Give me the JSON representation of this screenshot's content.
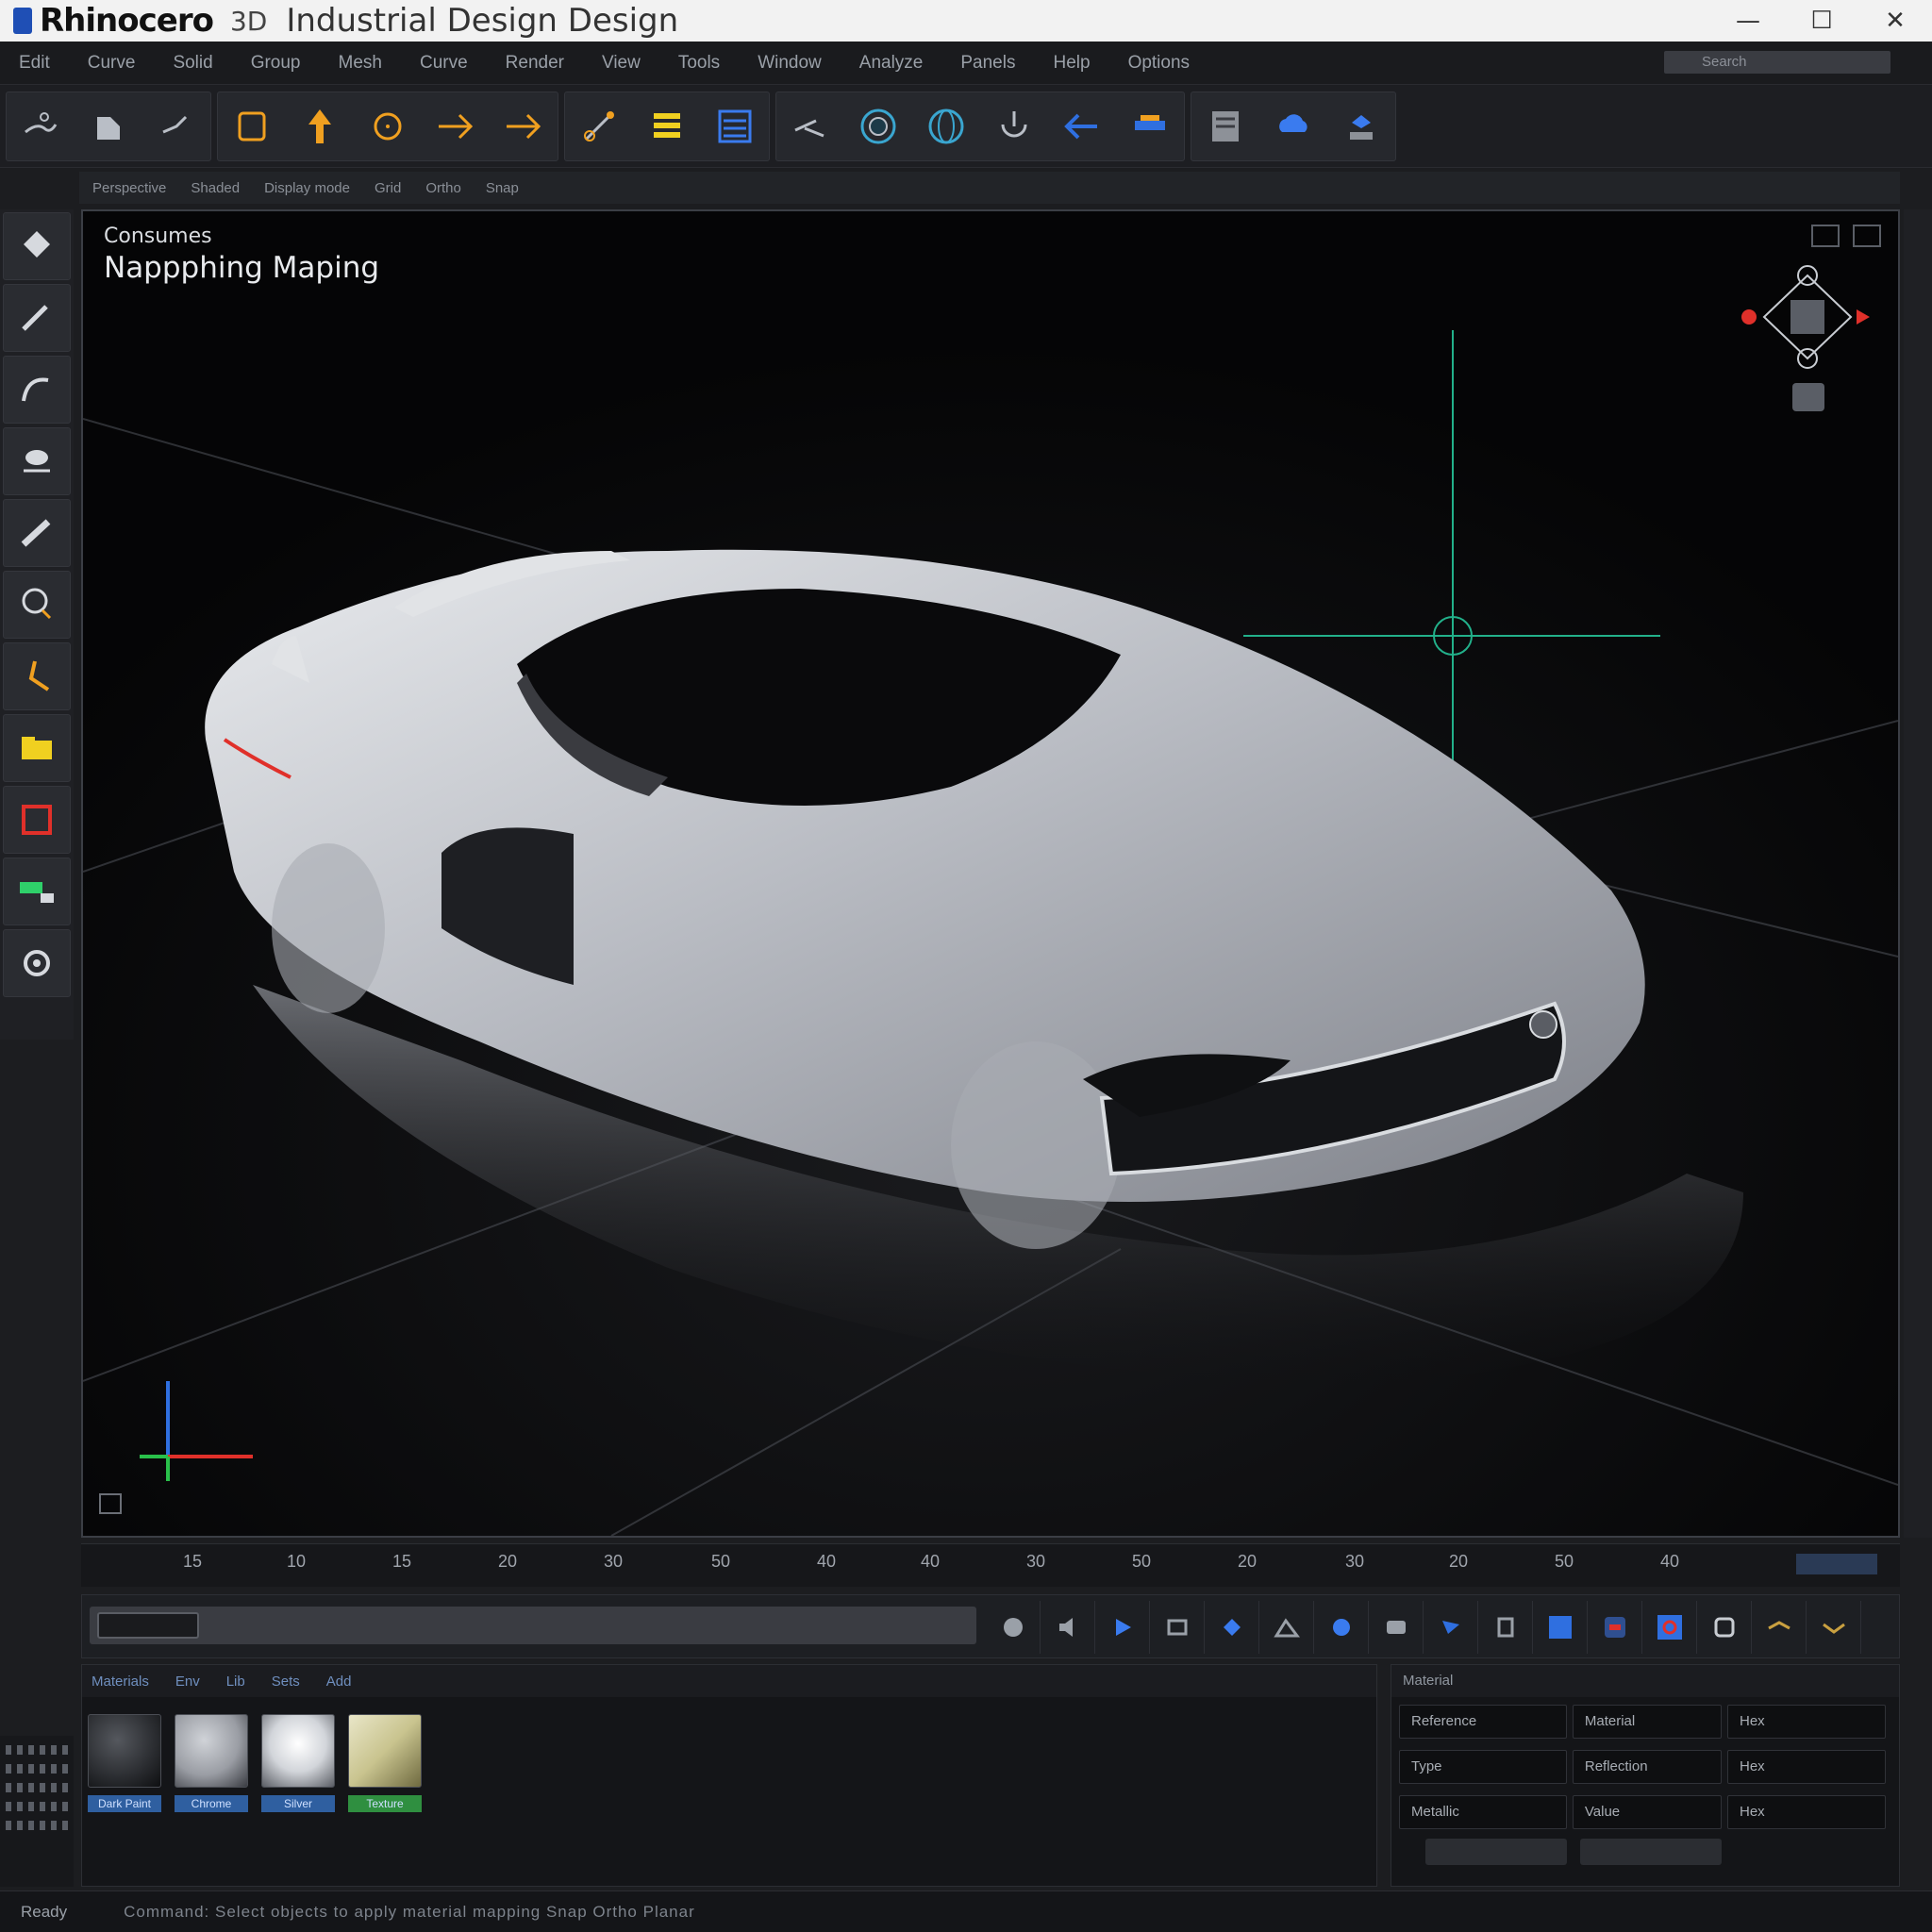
{
  "titlebar": {
    "app_name": "Rhinocero",
    "app_version": "3D",
    "document_title": "Industrial Design Design",
    "controls": {
      "minimize": "—",
      "maximize": "☐",
      "close": "✕"
    }
  },
  "menu": {
    "items": [
      "Edit",
      "Curve",
      "Solid",
      "Group",
      "Mesh",
      "Curve",
      "Render",
      "View",
      "Tools",
      "Window",
      "Analyze",
      "Panels",
      "Help",
      "Options"
    ],
    "search_placeholder": "Search"
  },
  "toolbar": {
    "tools": [
      {
        "icon": "select-icon",
        "color": "#b9bec6"
      },
      {
        "icon": "point-icon",
        "color": "#b9bec6"
      },
      {
        "icon": "line-icon",
        "color": "#b9bec6"
      },
      {
        "icon": "rectangle-icon",
        "color": "#f0a020"
      },
      {
        "icon": "move-icon",
        "color": "#f0a020"
      },
      {
        "icon": "circle-icon",
        "color": "#f0a020"
      },
      {
        "icon": "arrow-icon",
        "color": "#f0a020"
      },
      {
        "icon": "arrow-icon",
        "color": "#f0a020"
      },
      {
        "icon": "snap-icon",
        "color": "#f0a020"
      },
      {
        "icon": "layers-icon",
        "color": "#f0d020"
      },
      {
        "icon": "properties-icon",
        "color": "#3a7bef"
      },
      {
        "icon": "trim-icon",
        "color": "#b9bec6"
      },
      {
        "icon": "render-sphere-icon",
        "color": "#3aa6d0"
      },
      {
        "icon": "globe-icon",
        "color": "#3aa6d0"
      },
      {
        "icon": "rotate-icon",
        "color": "#b9bec6"
      },
      {
        "icon": "back-arrow-icon",
        "color": "#2f6fe0"
      },
      {
        "icon": "document-icon",
        "color": "#b9bec6"
      },
      {
        "icon": "cloud-icon",
        "color": "#3a7bef"
      },
      {
        "icon": "share-icon",
        "color": "#3a7bef"
      }
    ]
  },
  "viewport_strip": {
    "items": [
      "Perspective",
      "Shaded",
      "Display mode",
      "Grid",
      "Ortho",
      "Snap"
    ]
  },
  "left_tools": [
    {
      "icon": "gumball-icon",
      "color": "#d6d9de"
    },
    {
      "icon": "pen-icon",
      "color": "#d6d9de"
    },
    {
      "icon": "curve-icon",
      "color": "#d6d9de"
    },
    {
      "icon": "lamp-icon",
      "color": "#d6d9de"
    },
    {
      "icon": "ruler-icon",
      "color": "#d6d9de"
    },
    {
      "icon": "lasso-icon",
      "color": "#f0a020"
    },
    {
      "icon": "polyline-icon",
      "color": "#f0a020"
    },
    {
      "icon": "folder-icon",
      "color": "#f0d020"
    },
    {
      "icon": "stop-icon",
      "color": "#e0302a"
    },
    {
      "icon": "layer-panel-icon",
      "color": "#2fd06a"
    },
    {
      "icon": "settings-gear-icon",
      "color": "#d6d9de"
    }
  ],
  "viewport": {
    "label_small": "Consumes",
    "label_large": "Nappphing Maping",
    "colors": {
      "x_axis": "#e0302a",
      "y_axis": "#29c04a",
      "z_axis": "#2f6fe0",
      "guide": "#22b08a",
      "car_body": "#c9ccd2"
    }
  },
  "timeline": {
    "ticks": [
      "15",
      "10",
      "15",
      "20",
      "30",
      "50",
      "40",
      "40",
      "30",
      "50",
      "20",
      "30",
      "20",
      "50",
      "40"
    ]
  },
  "transport": {
    "buttons": [
      "record-icon",
      "speaker-icon",
      "play-icon",
      "loop-icon",
      "keyframe-icon",
      "mountain-icon",
      "shield-icon",
      "camera-icon",
      "flag-icon",
      "clip-icon",
      "square-blue-icon",
      "link-icon",
      "target-icon",
      "tag-icon",
      "fold-icon",
      "ribbon-icon"
    ]
  },
  "materials": {
    "tabs": [
      "Materials",
      "Env",
      "Lib",
      "Sets",
      "Add"
    ],
    "swatches": [
      {
        "name": "Dark Paint",
        "color": "#2a2c30"
      },
      {
        "name": "Chrome",
        "color": "#9a9da4"
      },
      {
        "name": "Silver",
        "color": "#d2d5da"
      },
      {
        "name": "Texture",
        "color": "#c9c48f"
      }
    ]
  },
  "properties": {
    "header": "Material",
    "rows": [
      {
        "label": "Reference",
        "value": "Material",
        "extra": "Hex"
      },
      {
        "label": "Type",
        "value": "Reflection",
        "extra": "Hex"
      },
      {
        "label": "Metallic",
        "value": "Value",
        "extra": "Hex"
      }
    ]
  },
  "statusbar": {
    "left": "Ready",
    "coords": "Command: Select objects to apply material mapping  Snap  Ortho  Planar"
  }
}
